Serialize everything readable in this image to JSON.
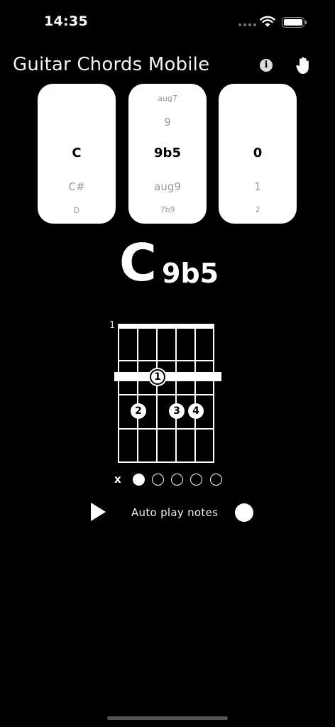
{
  "status": {
    "time": "14:35"
  },
  "header": {
    "title": "Guitar Chords Mobile",
    "info_icon": "info-icon",
    "hand_icon": "hand-icon"
  },
  "pickers": [
    {
      "name": "root",
      "far_above": "",
      "near_above": "",
      "selected": "C",
      "near_below": "C#",
      "far_below": "D"
    },
    {
      "name": "type",
      "far_above": "aug7",
      "near_above": "9",
      "selected": "9b5",
      "near_below": "aug9",
      "far_below": "7b9"
    },
    {
      "name": "variation",
      "far_above": "",
      "near_above": "",
      "selected": "0",
      "near_below": "1",
      "far_below": "2"
    }
  ],
  "chord": {
    "root": "C",
    "extension": "9b5"
  },
  "diagram": {
    "start_fret": "1",
    "fingers": [
      "1",
      "2",
      "3",
      "4"
    ],
    "mute_label": "x",
    "strings_played": [
      false,
      true,
      false,
      false,
      false,
      false
    ]
  },
  "playback": {
    "auto_play_label": "Auto play notes",
    "auto_play_enabled": true
  }
}
